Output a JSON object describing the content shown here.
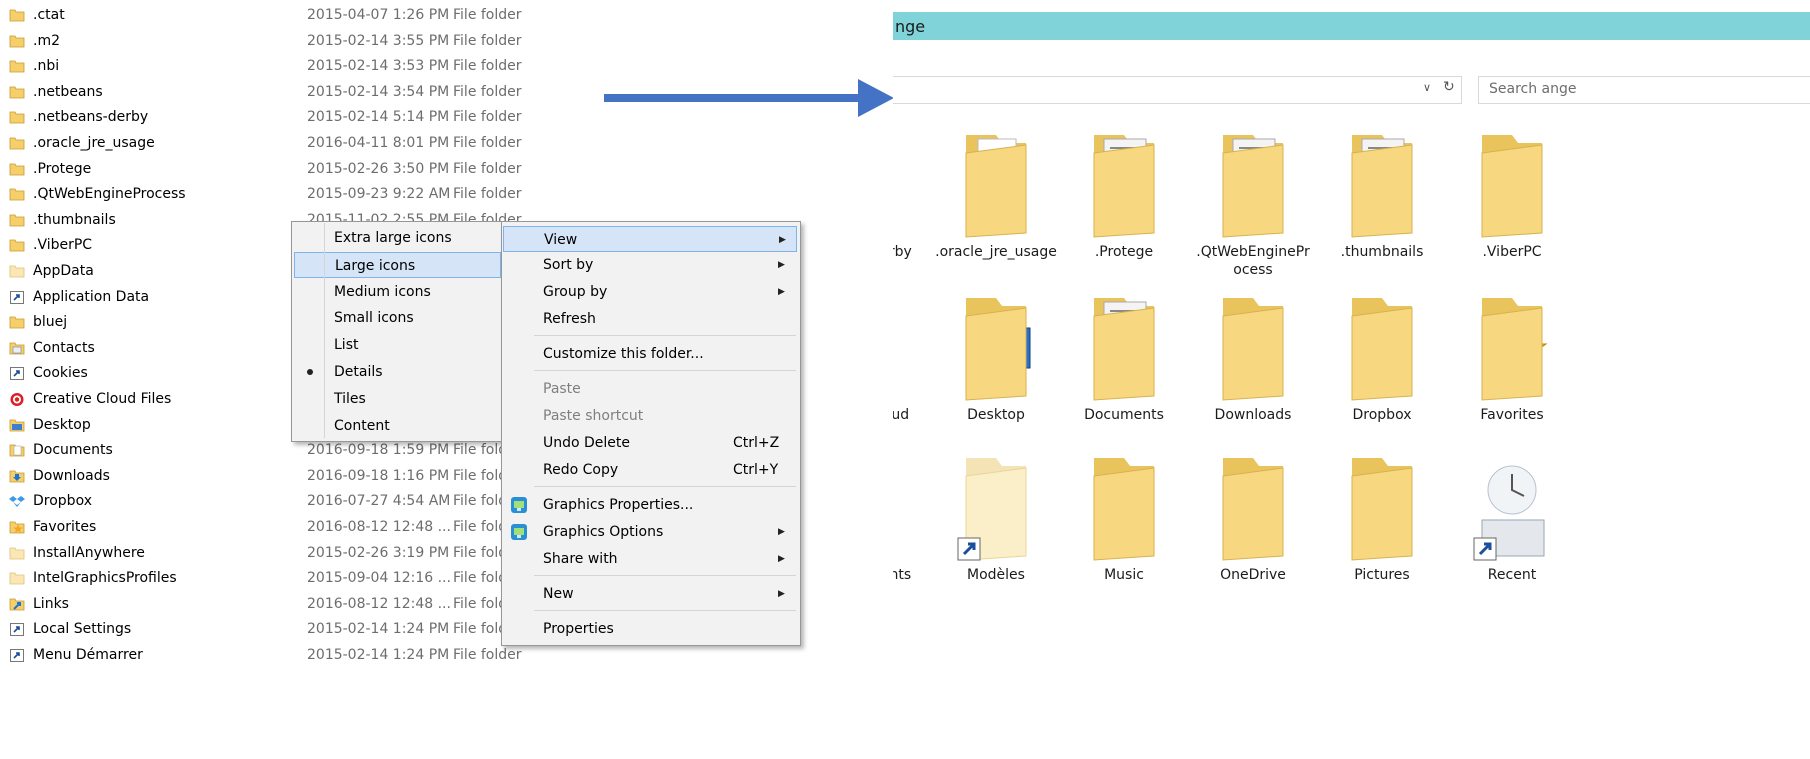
{
  "left_rows": [
    {
      "name": ".ctat",
      "date": "2015-04-07 1:26 PM",
      "type": "File folder",
      "icon": "folder-icon"
    },
    {
      "name": ".m2",
      "date": "2015-02-14 3:55 PM",
      "type": "File folder",
      "icon": "folder-icon"
    },
    {
      "name": ".nbi",
      "date": "2015-02-14 3:53 PM",
      "type": "File folder",
      "icon": "folder-icon"
    },
    {
      "name": ".netbeans",
      "date": "2015-02-14 3:54 PM",
      "type": "File folder",
      "icon": "folder-icon"
    },
    {
      "name": ".netbeans-derby",
      "date": "2015-02-14 5:14 PM",
      "type": "File folder",
      "icon": "folder-icon"
    },
    {
      "name": ".oracle_jre_usage",
      "date": "2016-04-11 8:01 PM",
      "type": "File folder",
      "icon": "folder-icon"
    },
    {
      "name": ".Protege",
      "date": "2015-02-26 3:50 PM",
      "type": "File folder",
      "icon": "folder-icon"
    },
    {
      "name": ".QtWebEngineProcess",
      "date": "2015-09-23 9:22 AM",
      "type": "File folder",
      "icon": "folder-icon"
    },
    {
      "name": ".thumbnails",
      "date": "2015-11-02 2:55 PM",
      "type": "File folder",
      "icon": "folder-icon"
    },
    {
      "name": ".ViberPC",
      "date": "",
      "type": "",
      "icon": "folder-icon"
    },
    {
      "name": "AppData",
      "date": "",
      "type": "",
      "icon": "hidden-folder-icon"
    },
    {
      "name": "Application Data",
      "date": "",
      "type": "",
      "icon": "shortcut-icon"
    },
    {
      "name": "bluej",
      "date": "",
      "type": "",
      "icon": "folder-icon"
    },
    {
      "name": "Contacts",
      "date": "",
      "type": "",
      "icon": "contacts-icon"
    },
    {
      "name": "Cookies",
      "date": "",
      "type": "",
      "icon": "shortcut-icon"
    },
    {
      "name": "Creative Cloud Files",
      "date": "",
      "type": "",
      "icon": "creative-cloud-icon"
    },
    {
      "name": "Desktop",
      "date": "",
      "type": "",
      "icon": "desktop-folder-icon"
    },
    {
      "name": "Documents",
      "date": "2016-09-18 1:59 PM",
      "type": "File fold",
      "icon": "documents-folder-icon"
    },
    {
      "name": "Downloads",
      "date": "2016-09-18 1:16 PM",
      "type": "File fold",
      "icon": "downloads-folder-icon"
    },
    {
      "name": "Dropbox",
      "date": "2016-07-27 4:54 AM",
      "type": "File fold",
      "icon": "dropbox-icon"
    },
    {
      "name": "Favorites",
      "date": "2016-08-12 12:48 ...",
      "type": "File fold",
      "icon": "favorites-folder-icon"
    },
    {
      "name": "InstallAnywhere",
      "date": "2015-02-26 3:19 PM",
      "type": "File fold",
      "icon": "hidden-folder-icon"
    },
    {
      "name": "IntelGraphicsProfiles",
      "date": "2015-09-04 12:16 ...",
      "type": "File fold",
      "icon": "hidden-folder-icon"
    },
    {
      "name": "Links",
      "date": "2016-08-12 12:48 ...",
      "type": "File fold",
      "icon": "links-folder-icon"
    },
    {
      "name": "Local Settings",
      "date": "2015-02-14 1:24 PM",
      "type": "File fold",
      "icon": "shortcut-icon"
    },
    {
      "name": "Menu Démarrer",
      "date": "2015-02-14 1:24 PM",
      "type": "File folder",
      "icon": "shortcut-icon"
    }
  ],
  "view_submenu": [
    {
      "label": "Extra large icons",
      "state": "normal"
    },
    {
      "label": "Large icons",
      "state": "highlighted"
    },
    {
      "label": "Medium icons",
      "state": "normal"
    },
    {
      "label": "Small icons",
      "state": "normal"
    },
    {
      "label": "List",
      "state": "normal"
    },
    {
      "label": "Details",
      "state": "selected"
    },
    {
      "label": "Tiles",
      "state": "normal"
    },
    {
      "label": "Content",
      "state": "normal"
    }
  ],
  "context_menu": {
    "view": "View",
    "sort_by": "Sort by",
    "group_by": "Group by",
    "refresh": "Refresh",
    "customize": "Customize this folder...",
    "paste": "Paste",
    "paste_shortcut": "Paste shortcut",
    "undo_delete": "Undo Delete",
    "undo_delete_shortcut": "Ctrl+Z",
    "redo_copy": "Redo Copy",
    "redo_copy_shortcut": "Ctrl+Y",
    "graphics_properties": "Graphics Properties...",
    "graphics_options": "Graphics Options",
    "share_with": "Share with",
    "new": "New",
    "properties": "Properties"
  },
  "right_window": {
    "title": "nge",
    "search_placeholder": "Search ange",
    "tiles_row1": [
      "erby",
      ".oracle_jre_usage",
      ".Protege",
      ".QtWebEnginePr\nocess",
      ".thumbnails",
      ".ViberPC"
    ],
    "tiles_row2": [
      "oud",
      "Desktop",
      "Documents",
      "Downloads",
      "Dropbox",
      "Favorites"
    ],
    "tiles_row3": [
      "ents",
      "Modèles",
      "Music",
      "OneDrive",
      "Pictures",
      "Recent"
    ]
  },
  "colors": {
    "title_bar": "#7fd3d9",
    "arrow": "#4472c4",
    "menu_bg": "#f2f2f2",
    "highlight": "#d5e5f7"
  }
}
